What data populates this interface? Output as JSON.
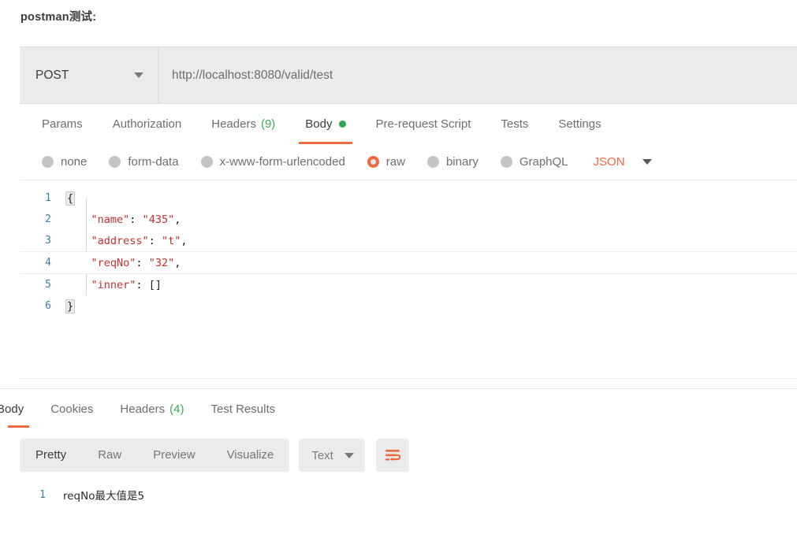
{
  "page": {
    "title": "postman测试:"
  },
  "request": {
    "method": "POST",
    "method_caret_icon": "chevron-down-icon",
    "url": "http://localhost:8080/valid/test",
    "tabs": [
      {
        "label": "Params",
        "count": "",
        "active": false,
        "dot": false
      },
      {
        "label": "Authorization",
        "count": "",
        "active": false,
        "dot": false
      },
      {
        "label": "Headers",
        "count": "(9)",
        "active": false,
        "dot": false
      },
      {
        "label": "Body",
        "count": "",
        "active": true,
        "dot": true
      },
      {
        "label": "Pre-request Script",
        "count": "",
        "active": false,
        "dot": false
      },
      {
        "label": "Tests",
        "count": "",
        "active": false,
        "dot": false
      },
      {
        "label": "Settings",
        "count": "",
        "active": false,
        "dot": false
      }
    ],
    "body_types": [
      {
        "label": "none",
        "selected": false
      },
      {
        "label": "form-data",
        "selected": false
      },
      {
        "label": "x-www-form-urlencoded",
        "selected": false
      },
      {
        "label": "raw",
        "selected": true
      },
      {
        "label": "binary",
        "selected": false
      },
      {
        "label": "GraphQL",
        "selected": false
      }
    ],
    "format": {
      "label": "JSON",
      "caret_icon": "chevron-down-icon",
      "color": "#f2683c"
    },
    "body_lines": [
      {
        "num": "1",
        "segments": [
          {
            "t": "{",
            "c": "brace"
          }
        ],
        "highlight": false
      },
      {
        "num": "2",
        "segments": [
          {
            "t": "    ",
            "c": "p"
          },
          {
            "t": "\"name\"",
            "c": "k"
          },
          {
            "t": ": ",
            "c": "p"
          },
          {
            "t": "\"435\"",
            "c": "s"
          },
          {
            "t": ",",
            "c": "p"
          }
        ],
        "highlight": false
      },
      {
        "num": "3",
        "segments": [
          {
            "t": "    ",
            "c": "p"
          },
          {
            "t": "\"address\"",
            "c": "k"
          },
          {
            "t": ": ",
            "c": "p"
          },
          {
            "t": "\"t\"",
            "c": "s"
          },
          {
            "t": ",",
            "c": "p"
          }
        ],
        "highlight": false
      },
      {
        "num": "4",
        "segments": [
          {
            "t": "    ",
            "c": "p"
          },
          {
            "t": "\"reqNo\"",
            "c": "k"
          },
          {
            "t": ": ",
            "c": "p"
          },
          {
            "t": "\"32\"",
            "c": "s"
          },
          {
            "t": ",",
            "c": "p"
          }
        ],
        "highlight": true
      },
      {
        "num": "5",
        "segments": [
          {
            "t": "    ",
            "c": "p"
          },
          {
            "t": "\"inner\"",
            "c": "k"
          },
          {
            "t": ": ",
            "c": "p"
          },
          {
            "t": "[]",
            "c": "p"
          }
        ],
        "highlight": false
      },
      {
        "num": "6",
        "segments": [
          {
            "t": "}",
            "c": "brace"
          }
        ],
        "highlight": false
      }
    ]
  },
  "response": {
    "tabs": [
      {
        "label": "Body",
        "count": "",
        "active": true
      },
      {
        "label": "Cookies",
        "count": "",
        "active": false
      },
      {
        "label": "Headers",
        "count": "(4)",
        "active": false
      },
      {
        "label": "Test Results",
        "count": "",
        "active": false
      }
    ],
    "view_modes": [
      {
        "label": "Pretty",
        "active": true
      },
      {
        "label": "Raw",
        "active": false
      },
      {
        "label": "Preview",
        "active": false
      },
      {
        "label": "Visualize",
        "active": false
      }
    ],
    "content_type": {
      "label": "Text",
      "caret_icon": "chevron-down-icon"
    },
    "wrap_button_icon": "word-wrap-icon",
    "body_lines": [
      {
        "num": "1",
        "text": "reqNo最大值是5"
      }
    ]
  },
  "colors": {
    "accent": "#ef6c3d",
    "badge_green": "#2fa84f",
    "toolbar_gray": "#ebebeb",
    "line_number": "#3a7f9d",
    "json_string": "#c42f2f"
  }
}
